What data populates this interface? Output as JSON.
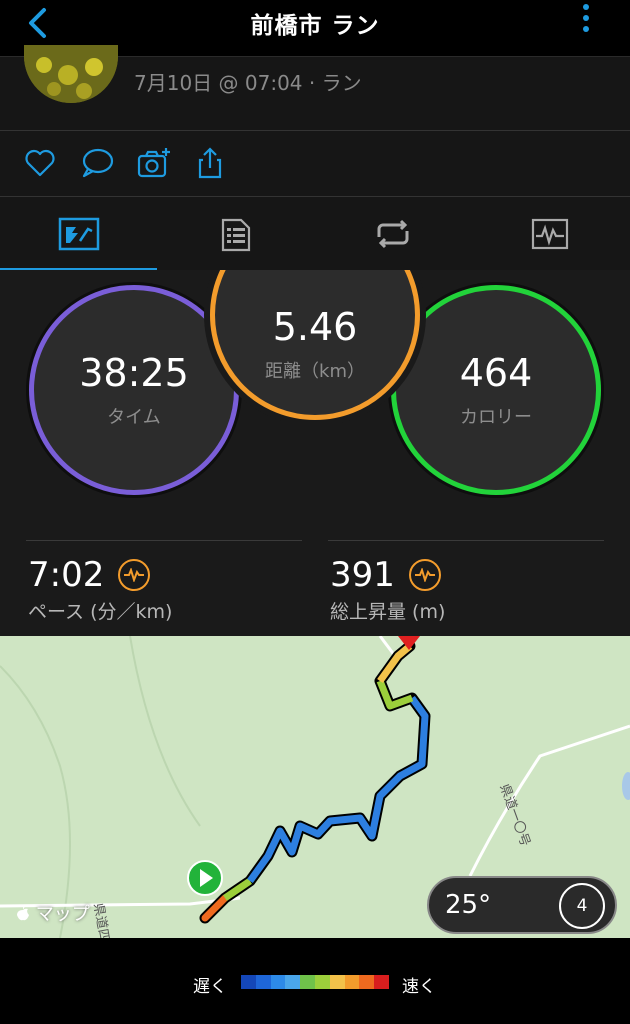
{
  "nav": {
    "title": "前橋市 ラン"
  },
  "header": {
    "date_line": "7月10日 @ 07:04 · ラン"
  },
  "tabs": [
    "overview-tab",
    "details-tab",
    "laps-tab",
    "charts-tab"
  ],
  "stats": {
    "distance": {
      "value": "5.46",
      "label": "距離（km）"
    },
    "time": {
      "value": "38:25",
      "label": "タイム"
    },
    "calories": {
      "value": "464",
      "label": "カロリー"
    },
    "pace": {
      "value": "7:02",
      "label": "ペース (分／km)"
    },
    "elevation": {
      "value": "391",
      "label": "総上昇量 (m)"
    }
  },
  "map": {
    "attribution": "マップ",
    "road_label_1": "県道一〇号",
    "road_label_2": "県道四号",
    "weather_temp": "25°",
    "wind_speed": "4"
  },
  "legend": {
    "slow": "遅く",
    "fast": "速く",
    "colors": [
      "#1447b8",
      "#1e66d8",
      "#2d8ae8",
      "#4aa6ea",
      "#6fc24a",
      "#9ccf3b",
      "#f3c24a",
      "#f39c2c",
      "#ef6a1f",
      "#d91e1e"
    ]
  },
  "colors": {
    "accent": "#1e9be0",
    "time_ring": "#7a5ed8",
    "distance_ring": "#f39c2c",
    "calories_ring": "#22d33a"
  }
}
